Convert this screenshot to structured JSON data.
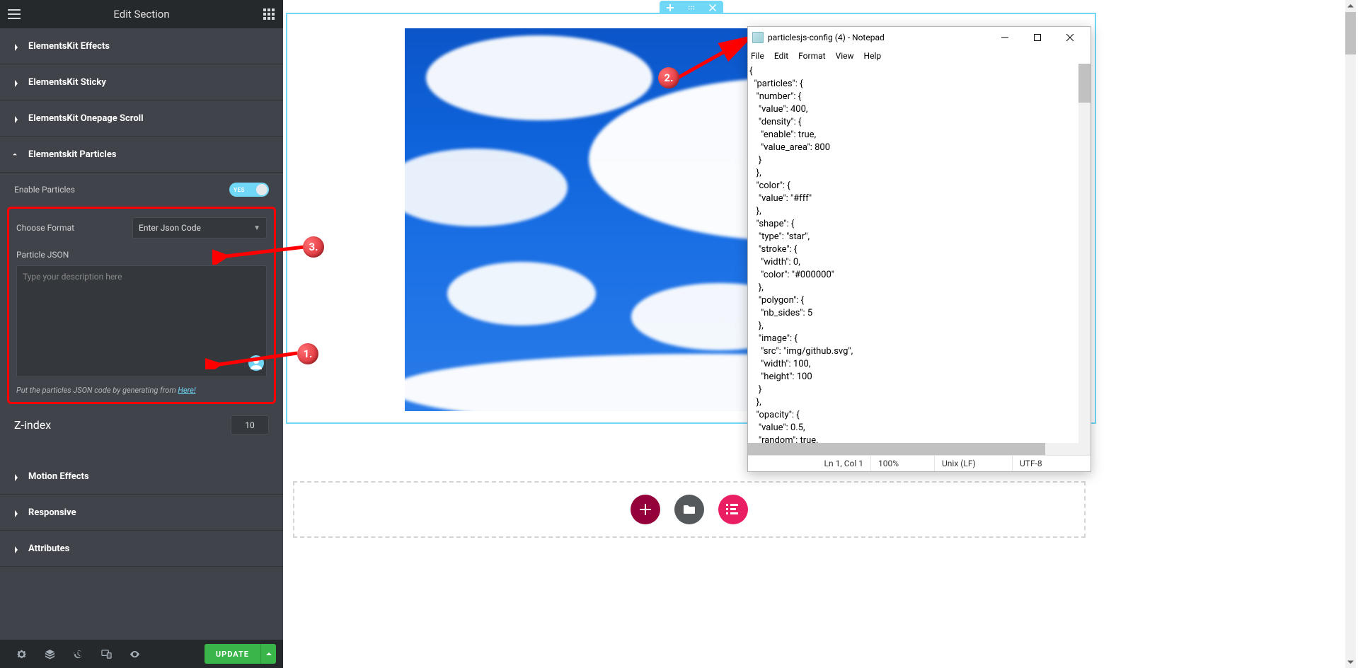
{
  "panel": {
    "title": "Edit Section",
    "sections": {
      "effects": "ElementsKit Effects",
      "sticky": "ElementsKit Sticky",
      "onepage": "ElementsKit Onepage Scroll",
      "particles": "Elementskit Particles",
      "motion": "Motion Effects",
      "responsive": "Responsive",
      "attributes": "Attributes"
    },
    "enable_label": "Enable Particles",
    "toggle_text": "YES",
    "choose_format_label": "Choose Format",
    "choose_format_value": "Enter Json Code",
    "particle_json_label": "Particle JSON",
    "json_placeholder": "Type your description here",
    "hint_prefix": "Put the particles JSON code by generating from ",
    "hint_link": "Here!",
    "zindex_label": "Z-index",
    "zindex_value": "10",
    "update_label": "UPDATE"
  },
  "annotations": {
    "a1": "1.",
    "a2": "2.",
    "a3": "3."
  },
  "notepad": {
    "title": "particlesjs-config (4) - Notepad",
    "menu": {
      "file": "File",
      "edit": "Edit",
      "format": "Format",
      "view": "View",
      "help": "Help"
    },
    "body": "{\n  \"particles\": {\n   \"number\": {\n    \"value\": 400,\n    \"density\": {\n     \"enable\": true,\n     \"value_area\": 800\n    }\n   },\n   \"color\": {\n    \"value\": \"#fff\"\n   },\n   \"shape\": {\n    \"type\": \"star\",\n    \"stroke\": {\n     \"width\": 0,\n     \"color\": \"#000000\"\n    },\n    \"polygon\": {\n     \"nb_sides\": 5\n    },\n    \"image\": {\n     \"src\": \"img/github.svg\",\n     \"width\": 100,\n     \"height\": 100\n    }\n   },\n   \"opacity\": {\n    \"value\": 0.5,\n    \"random\": true,",
    "status": {
      "pos": "Ln 1, Col 1",
      "zoom": "100%",
      "eol": "Unix (LF)",
      "enc": "UTF-8"
    }
  }
}
